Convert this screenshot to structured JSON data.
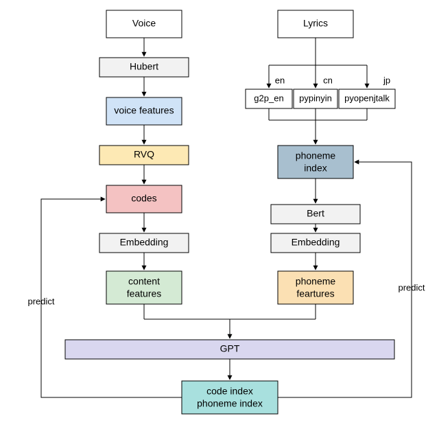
{
  "left": {
    "voice": "Voice",
    "hubert": "Hubert",
    "voice_features": "voice features",
    "rvq": "RVQ",
    "codes": "codes",
    "embedding": "Embedding",
    "content_features_l1": "content",
    "content_features_l2": "features"
  },
  "right": {
    "lyrics": "Lyrics",
    "lang_en": "en",
    "lang_cn": "cn",
    "lang_jp": "jp",
    "g2p_en": "g2p_en",
    "pypinyin": "pypinyin",
    "pyopenjtalk": "pyopenjtalk",
    "phoneme_index_l1": "phoneme",
    "phoneme_index_l2": "index",
    "bert": "Bert",
    "embedding": "Embedding",
    "phoneme_features_l1": "phoneme",
    "phoneme_features_l2": "feartures"
  },
  "bottom": {
    "gpt": "GPT",
    "output_l1": "code index",
    "output_l2": "phoneme index"
  },
  "labels": {
    "predict_left": "predict",
    "predict_right": "predict"
  },
  "colors": {
    "white": "#ffffff",
    "grey": "#f2f2f2",
    "blue_light": "#d0e3f7",
    "yellow": "#fde9b4",
    "red": "#f4c2c2",
    "green": "#d4ead4",
    "slate": "#a8bfcf",
    "orange": "#fbe0b3",
    "lavender": "#d9d7ef",
    "teal": "#a8e0de"
  }
}
